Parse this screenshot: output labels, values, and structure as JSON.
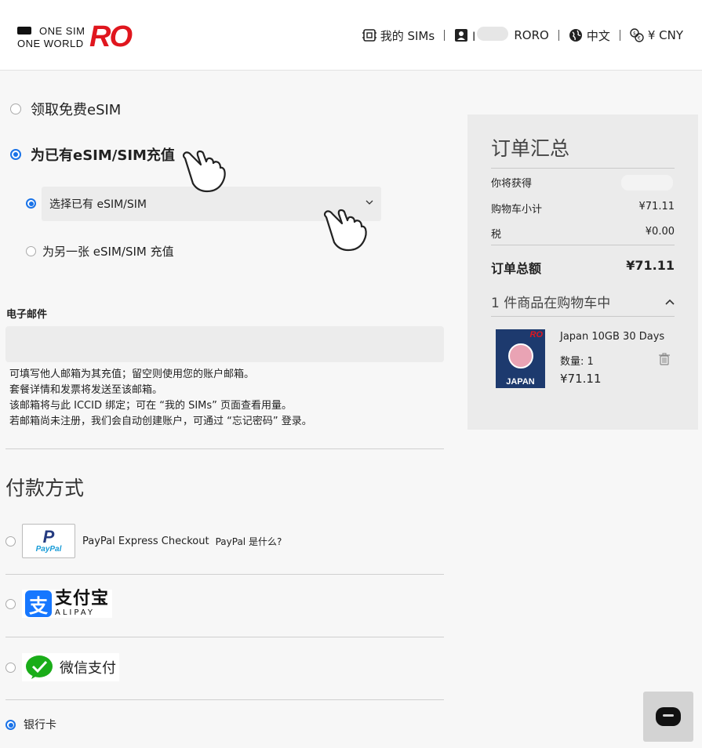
{
  "header": {
    "logo_line1": "ONE SIM",
    "logo_line2": "ONE WORLD",
    "logo_brand": "RO",
    "nav": {
      "my_sims": "我的 SIMs",
      "user_name_suffix": "RORO",
      "language": "中文",
      "currency": "¥ CNY"
    }
  },
  "topup": {
    "option_free": "领取免费eSIM",
    "option_recharge": "为已有eSIM/SIM充值",
    "select_placeholder": "选择已有 eSIM/SIM",
    "option_other": "为另一张 eSIM/SIM 充值"
  },
  "email": {
    "label": "电子邮件",
    "value": "",
    "hints": [
      "可填写他人邮箱为其充值；留空则使用您的账户邮箱。",
      "套餐详情和发票将发送至该邮箱。",
      "该邮箱将与此 ICCID 绑定；可在 “我的 SIMs” 页面查看用量。",
      "若邮箱尚未注册，我们会自动创建账户，可通过 “忘记密码” 登录。"
    ]
  },
  "payment": {
    "title": "付款方式",
    "paypal_logo_p": "P",
    "paypal_logo_word": "PayPal",
    "paypal_label": "PayPal Express Checkout",
    "paypal_what": "PayPal 是什么?",
    "alipay_icon": "支",
    "alipay_cn": "支付宝",
    "alipay_en": "ALIPAY",
    "wechat_label": "微信支付",
    "bank_label": "银行卡"
  },
  "summary": {
    "title": "订单汇总",
    "receive_label": "你将获得",
    "subtotal_label": "购物车小计",
    "subtotal_value": "¥71.11",
    "tax_label": "税",
    "tax_value": "¥0.00",
    "total_label": "订单总额",
    "total_value": "¥71.11",
    "cart_count": "1 件商品在购物车中",
    "product": {
      "image_brand": "RO",
      "image_label": "JAPAN",
      "name": "Japan 10GB 30 Days",
      "qty": "数量: 1",
      "price": "¥71.11"
    }
  },
  "colors": {
    "brand_red": "#e0161e",
    "radio_blue": "#1a73e8",
    "summary_bg": "#ebebeb"
  }
}
